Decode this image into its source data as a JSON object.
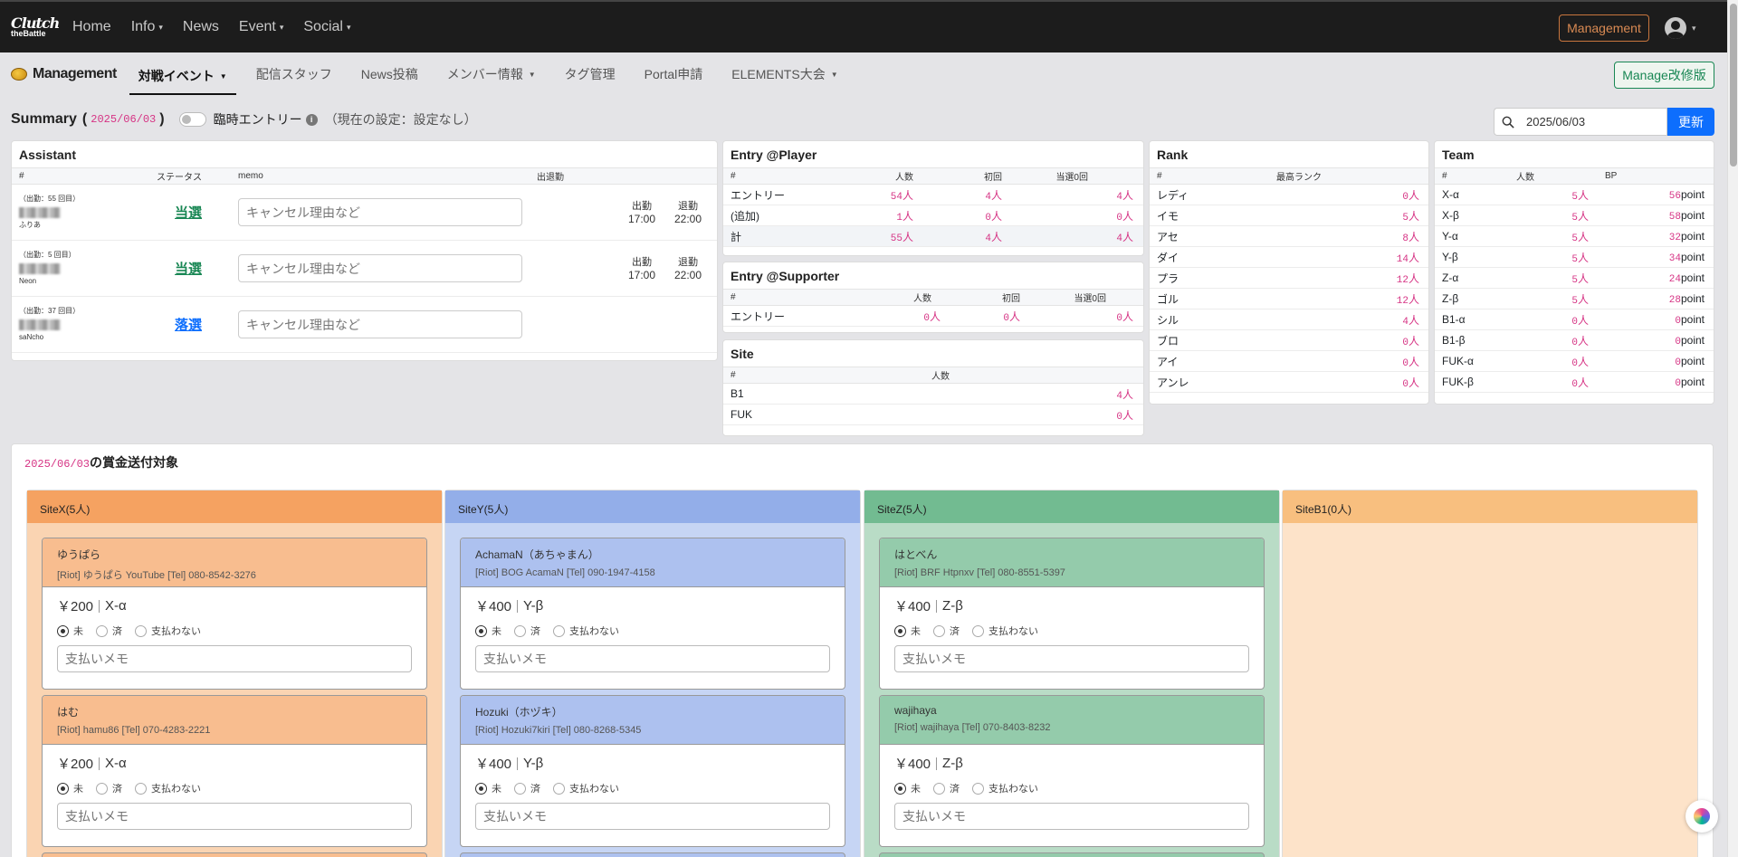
{
  "topnav": {
    "logo_line1": "Clutch",
    "logo_line2": "theBattle",
    "items": [
      {
        "label": "Home",
        "dropdown": false
      },
      {
        "label": "Info",
        "dropdown": true
      },
      {
        "label": "News",
        "dropdown": false
      },
      {
        "label": "Event",
        "dropdown": true
      },
      {
        "label": "Social",
        "dropdown": true
      }
    ],
    "management_button": "Management"
  },
  "subnav": {
    "brand": "Management",
    "items": [
      {
        "label": "対戦イベント",
        "dropdown": true,
        "active": true
      },
      {
        "label": "配信スタッフ",
        "dropdown": false
      },
      {
        "label": "News投稿",
        "dropdown": false
      },
      {
        "label": "メンバー情報",
        "dropdown": true
      },
      {
        "label": "タグ管理",
        "dropdown": false
      },
      {
        "label": "Portal申請",
        "dropdown": false
      },
      {
        "label": "ELEMENTS大会",
        "dropdown": true
      }
    ],
    "manage_button": "Manage改修版"
  },
  "summary": {
    "title": "Summary",
    "paren_open": "(",
    "date": "2025/06/03",
    "paren_close": ")",
    "temp_entry_label": "臨時エントリー",
    "current_setting": "（現在の設定：設定なし）",
    "search_value": "2025/06/03",
    "update_button": "更新"
  },
  "assistant": {
    "title": "Assistant",
    "headers": [
      "#",
      "ステータス",
      "memo",
      "出退勤"
    ],
    "memo_placeholder": "キャンセル理由など",
    "clock_in_label": "出勤",
    "clock_out_label": "退勤",
    "rows": [
      {
        "count": "（出勤：55 回目）",
        "name": "ふりあ",
        "status": "当選",
        "status_type": "win",
        "in": "17:00",
        "out": "22:00"
      },
      {
        "count": "（出勤：5 回目）",
        "name": "Neon",
        "status": "当選",
        "status_type": "win",
        "in": "17:00",
        "out": "22:00"
      },
      {
        "count": "（出勤：37 回目）",
        "name": "saNcho",
        "status": "落選",
        "status_type": "lose",
        "in": "",
        "out": ""
      }
    ]
  },
  "entry_player": {
    "title": "Entry @Player",
    "headers": [
      "#",
      "人数",
      "初回",
      "当選0回"
    ],
    "unit": "人",
    "rows": [
      {
        "label": "エントリー",
        "v1": "54",
        "v2": "4",
        "v3": "4"
      },
      {
        "label": "(追加)",
        "v1": "1",
        "v2": "0",
        "v3": "0"
      },
      {
        "label": "計",
        "v1": "55",
        "v2": "4",
        "v3": "4"
      }
    ]
  },
  "entry_supporter": {
    "title": "Entry @Supporter",
    "headers": [
      "#",
      "人数",
      "初回",
      "当選0回"
    ],
    "rows": [
      {
        "label": "エントリー",
        "v1": "0",
        "v2": "0",
        "v3": "0"
      }
    ]
  },
  "site": {
    "title": "Site",
    "headers": [
      "#",
      "人数"
    ],
    "rows": [
      {
        "label": "B1",
        "v1": "4"
      },
      {
        "label": "FUK",
        "v1": "0"
      }
    ]
  },
  "rank": {
    "title": "Rank",
    "headers": [
      "#",
      "最高ランク"
    ],
    "rows": [
      {
        "label": "レディ",
        "v1": "0"
      },
      {
        "label": "イモ",
        "v1": "5"
      },
      {
        "label": "アセ",
        "v1": "8"
      },
      {
        "label": "ダイ",
        "v1": "14"
      },
      {
        "label": "プラ",
        "v1": "12"
      },
      {
        "label": "ゴル",
        "v1": "12"
      },
      {
        "label": "シル",
        "v1": "4"
      },
      {
        "label": "ブロ",
        "v1": "0"
      },
      {
        "label": "アイ",
        "v1": "0"
      },
      {
        "label": "アンレ",
        "v1": "0"
      }
    ]
  },
  "team": {
    "title": "Team",
    "headers": [
      "#",
      "人数",
      "BP"
    ],
    "point_unit": "point",
    "rows": [
      {
        "label": "X-α",
        "v1": "5",
        "bp": "56"
      },
      {
        "label": "X-β",
        "v1": "5",
        "bp": "58"
      },
      {
        "label": "Y-α",
        "v1": "5",
        "bp": "32"
      },
      {
        "label": "Y-β",
        "v1": "5",
        "bp": "34"
      },
      {
        "label": "Z-α",
        "v1": "5",
        "bp": "24"
      },
      {
        "label": "Z-β",
        "v1": "5",
        "bp": "28"
      },
      {
        "label": "B1-α",
        "v1": "0",
        "bp": "0"
      },
      {
        "label": "B1-β",
        "v1": "0",
        "bp": "0"
      },
      {
        "label": "FUK-α",
        "v1": "0",
        "bp": "0"
      },
      {
        "label": "FUK-β",
        "v1": "0",
        "bp": "0"
      }
    ]
  },
  "prize": {
    "date": "2025/06/03",
    "title_suffix": "の賞金送付対象",
    "radio_labels": [
      "未",
      "済",
      "支払わない"
    ],
    "memo_placeholder": "支払いメモ",
    "columns": [
      {
        "label": "SiteX(5人)",
        "head_color": "#f5a261",
        "body_color": "#fad4b2",
        "card_head": "#f8bd8f",
        "cards": [
          {
            "name": "ゆうぱら",
            "contact": "[Riot] ゆうぱら YouTube [Tel] 080-8542-3276",
            "amount": "￥200",
            "team": "X-α"
          },
          {
            "name": "はむ",
            "contact": "[Riot] hamu86 [Tel] 070-4283-2221",
            "amount": "￥200",
            "team": "X-α"
          }
        ]
      },
      {
        "label": "SiteY(5人)",
        "head_color": "#93aee9",
        "body_color": "#c6d5f4",
        "card_head": "#adc1ef",
        "cards": [
          {
            "name": "AchamaN（あちゃまん）",
            "contact": "[Riot] BOG AcamaN [Tel] 090-1947-4158",
            "amount": "￥400",
            "team": "Y-β"
          },
          {
            "name": "Hozuki（ホヅキ）",
            "contact": "[Riot] Hozuki7kiri [Tel] 080-8268-5345",
            "amount": "￥400",
            "team": "Y-β"
          }
        ]
      },
      {
        "label": "SiteZ(5人)",
        "head_color": "#72bb91",
        "body_color": "#b9dcc6",
        "card_head": "#94cbab",
        "cards": [
          {
            "name": "はとべん",
            "contact": "[Riot] BRF Htpnxv [Tel] 080-8551-5397",
            "amount": "￥400",
            "team": "Z-β"
          },
          {
            "name": "wajihaya",
            "contact": "[Riot] wajihaya [Tel] 070-8403-8232",
            "amount": "￥400",
            "team": "Z-β"
          }
        ]
      },
      {
        "label": "SiteB1(0人)",
        "head_color": "#f8bf7f",
        "body_color": "#fde3c9",
        "card_head": "#f8bf7f",
        "cards": []
      }
    ]
  }
}
